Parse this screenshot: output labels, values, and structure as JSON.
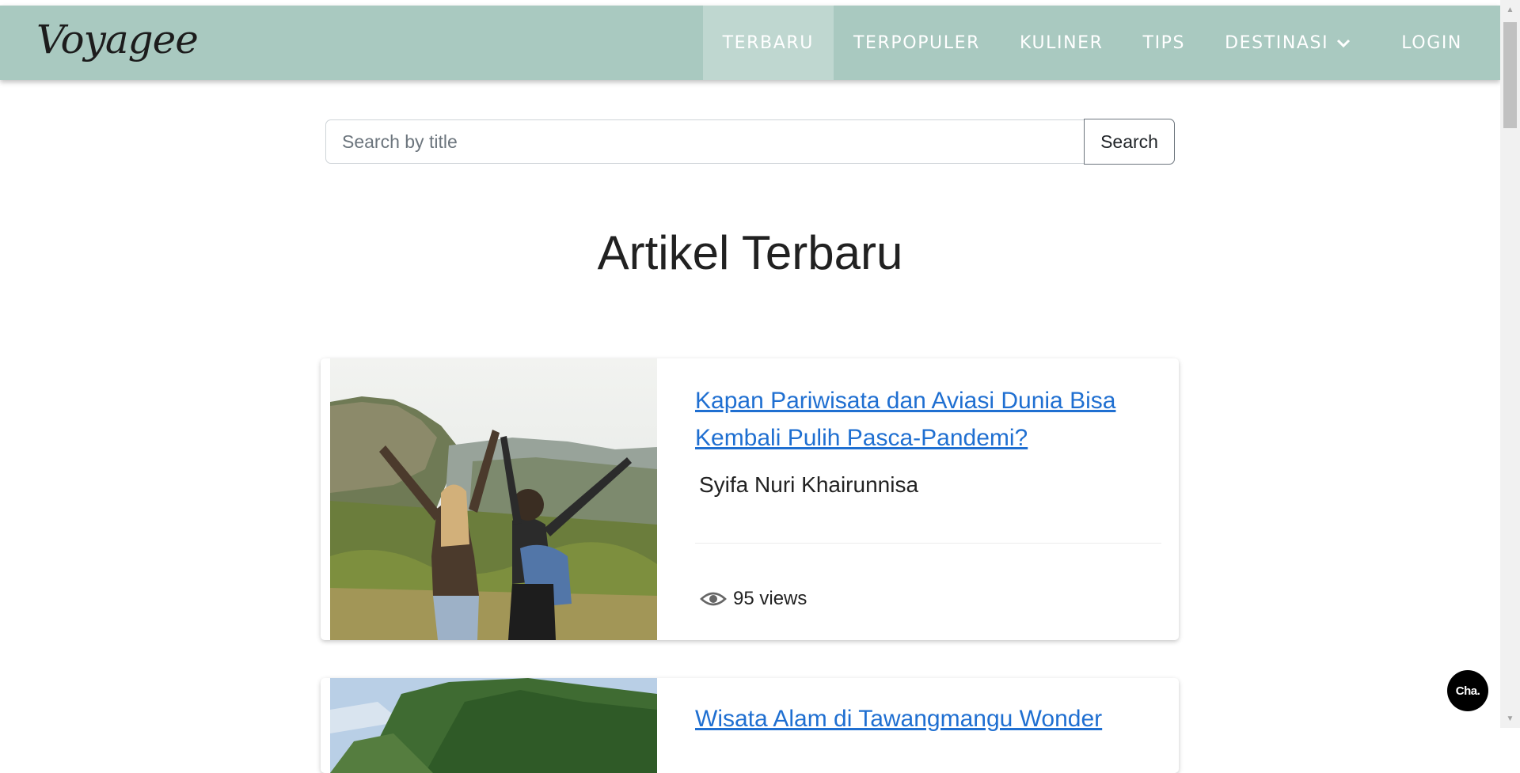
{
  "header": {
    "brand": "Voyagee",
    "nav": [
      {
        "label": "TERBARU",
        "active": true
      },
      {
        "label": "TERPOPULER",
        "active": false
      },
      {
        "label": "KULINER",
        "active": false
      },
      {
        "label": "TIPS",
        "active": false
      },
      {
        "label": "DESTINASI",
        "active": false,
        "icon": "chevron-down-icon"
      },
      {
        "label": "LOGIN",
        "active": false
      }
    ]
  },
  "search": {
    "placeholder": "Search by title",
    "value": "",
    "button_label": "Search"
  },
  "main": {
    "title": "Artikel Terbaru",
    "articles": [
      {
        "title": "Kapan Pariwisata dan Aviasi Dunia Bisa Kembali Pulih Pasca-Pandemi?",
        "author": "Syifa Nuri Khairunnisa",
        "views": "95 views",
        "image": "two-travelers-cliff-photo"
      },
      {
        "title": "Wisata Alam di Tawangmangu Wonder",
        "image": "forest-hill-photo"
      }
    ]
  },
  "chat": {
    "label": "Cha."
  },
  "colors": {
    "navbar": "#a9c9c0",
    "nav_active": "#bfd7d0",
    "link": "#1f6fd1"
  }
}
